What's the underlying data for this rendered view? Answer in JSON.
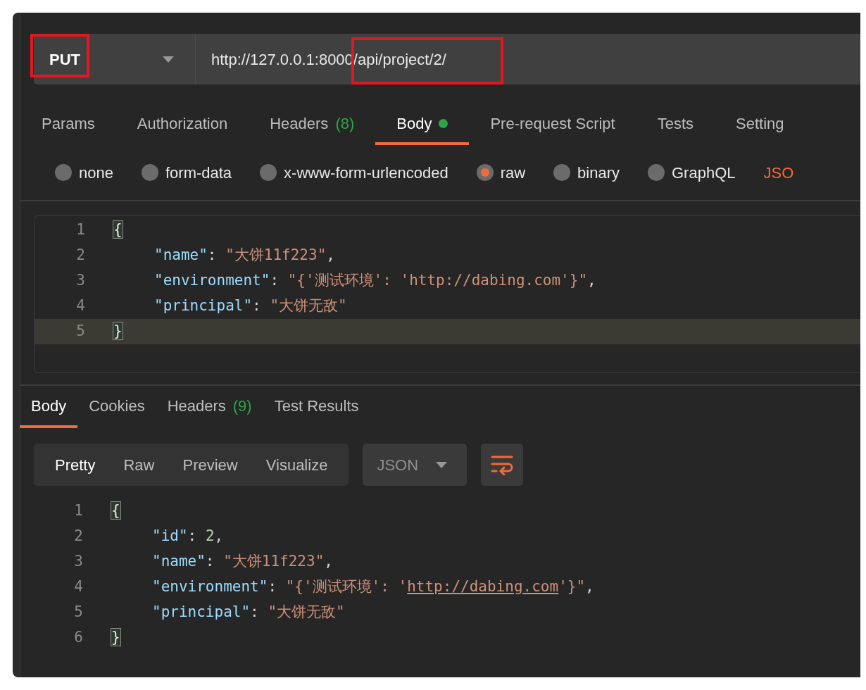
{
  "request": {
    "method": "PUT",
    "url": "http://127.0.0.1:8000/api/project/2/"
  },
  "request_tabs": [
    {
      "label": "Params",
      "selected": false,
      "indicator": false
    },
    {
      "label": "Authorization",
      "selected": false,
      "indicator": false
    },
    {
      "label": "Headers",
      "count": "(8)",
      "selected": false,
      "indicator": false
    },
    {
      "label": "Body",
      "selected": true,
      "indicator": true
    },
    {
      "label": "Pre-request Script",
      "selected": false,
      "indicator": false
    },
    {
      "label": "Tests",
      "selected": false,
      "indicator": false
    },
    {
      "label": "Setting",
      "selected": false,
      "indicator": false
    }
  ],
  "body_types": [
    {
      "label": "none",
      "selected": false
    },
    {
      "label": "form-data",
      "selected": false
    },
    {
      "label": "x-www-form-urlencoded",
      "selected": false
    },
    {
      "label": "raw",
      "selected": true
    },
    {
      "label": "binary",
      "selected": false
    },
    {
      "label": "GraphQL",
      "selected": false
    }
  ],
  "body_format": "JSO",
  "request_body": {
    "lines": [
      {
        "number": "1",
        "active": false,
        "indented": false,
        "tokens": [
          {
            "kind": "bracket",
            "text": "{"
          }
        ]
      },
      {
        "number": "2",
        "active": false,
        "indented": true,
        "tokens": [
          {
            "kind": "key",
            "text": "\"name\""
          },
          {
            "kind": "punct",
            "text": ": "
          },
          {
            "kind": "string",
            "text": "\"大饼11f223\""
          },
          {
            "kind": "punct",
            "text": ","
          }
        ]
      },
      {
        "number": "3",
        "active": false,
        "indented": true,
        "tokens": [
          {
            "kind": "key",
            "text": "\"environment\""
          },
          {
            "kind": "punct",
            "text": ": "
          },
          {
            "kind": "string",
            "text": "\"{'测试环境': 'http://dabing.com'}\""
          },
          {
            "kind": "punct",
            "text": ","
          }
        ]
      },
      {
        "number": "4",
        "active": false,
        "indented": true,
        "tokens": [
          {
            "kind": "key",
            "text": "\"principal\""
          },
          {
            "kind": "punct",
            "text": ": "
          },
          {
            "kind": "string",
            "text": "\"大饼无敌\""
          }
        ]
      },
      {
        "number": "5",
        "active": true,
        "indented": false,
        "tokens": [
          {
            "kind": "bracket",
            "text": "}"
          }
        ]
      }
    ]
  },
  "response_tabs": [
    {
      "label": "Body",
      "selected": true
    },
    {
      "label": "Cookies",
      "selected": false
    },
    {
      "label": "Headers",
      "count": "(9)",
      "selected": false
    },
    {
      "label": "Test Results",
      "selected": false
    }
  ],
  "view_modes": [
    {
      "label": "Pretty",
      "selected": true
    },
    {
      "label": "Raw",
      "selected": false
    },
    {
      "label": "Preview",
      "selected": false
    },
    {
      "label": "Visualize",
      "selected": false
    }
  ],
  "response_format": "JSON",
  "response_body": {
    "lines": [
      {
        "number": "1",
        "active": false,
        "indented": false,
        "tokens": [
          {
            "kind": "bracket",
            "text": "{"
          }
        ]
      },
      {
        "number": "2",
        "active": false,
        "indented": true,
        "tokens": [
          {
            "kind": "key",
            "text": "\"id\""
          },
          {
            "kind": "punct",
            "text": ": "
          },
          {
            "kind": "number",
            "text": "2"
          },
          {
            "kind": "punct",
            "text": ","
          }
        ]
      },
      {
        "number": "3",
        "active": false,
        "indented": true,
        "tokens": [
          {
            "kind": "key",
            "text": "\"name\""
          },
          {
            "kind": "punct",
            "text": ": "
          },
          {
            "kind": "string",
            "text": "\"大饼11f223\""
          },
          {
            "kind": "punct",
            "text": ","
          }
        ]
      },
      {
        "number": "4",
        "active": false,
        "indented": true,
        "tokens": [
          {
            "kind": "key",
            "text": "\"environment\""
          },
          {
            "kind": "punct",
            "text": ": "
          },
          {
            "kind": "string",
            "text": "\"{'测试环境': '"
          },
          {
            "kind": "link",
            "text": "http://dabing.com"
          },
          {
            "kind": "string",
            "text": "'}\""
          },
          {
            "kind": "punct",
            "text": ","
          }
        ]
      },
      {
        "number": "5",
        "active": false,
        "indented": true,
        "tokens": [
          {
            "kind": "key",
            "text": "\"principal\""
          },
          {
            "kind": "punct",
            "text": ": "
          },
          {
            "kind": "string",
            "text": "\"大饼无敌\""
          }
        ]
      },
      {
        "number": "6",
        "active": false,
        "indented": false,
        "tokens": [
          {
            "kind": "bracket",
            "text": "}"
          }
        ]
      }
    ]
  }
}
